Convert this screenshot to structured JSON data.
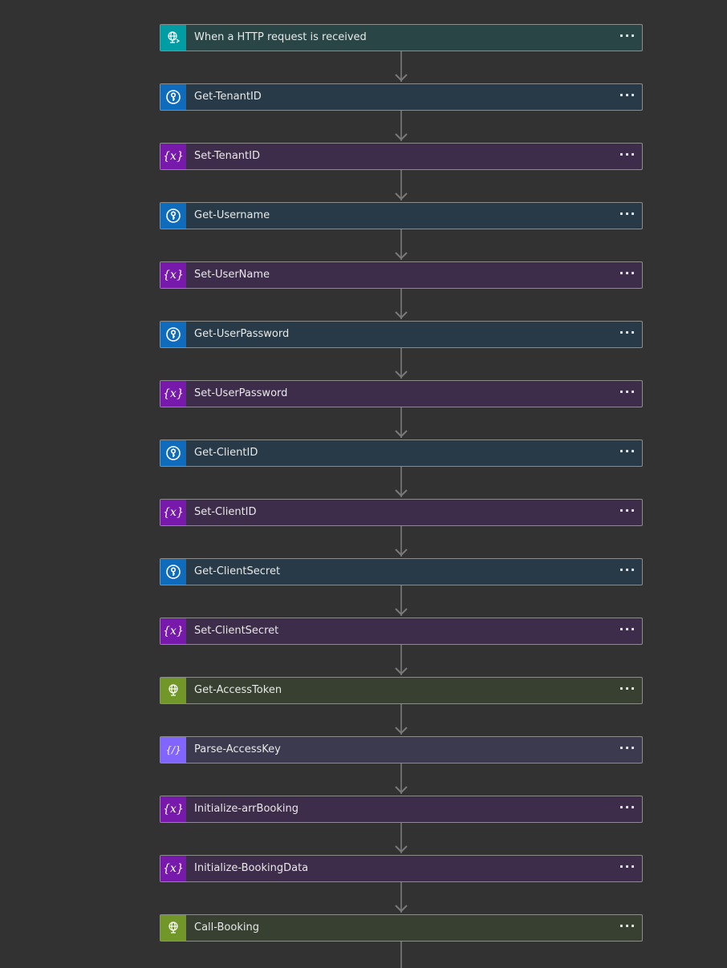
{
  "flow": {
    "steps": [
      {
        "label": "When a HTTP request is received",
        "kind": "request",
        "icon": "request-globe-icon"
      },
      {
        "label": "Get-TenantID",
        "kind": "keyvault",
        "icon": "key-vault-icon"
      },
      {
        "label": "Set-TenantID",
        "kind": "variable",
        "icon": "variable-icon"
      },
      {
        "label": "Get-Username",
        "kind": "keyvault",
        "icon": "key-vault-icon"
      },
      {
        "label": "Set-UserName",
        "kind": "variable",
        "icon": "variable-icon"
      },
      {
        "label": "Get-UserPassword",
        "kind": "keyvault",
        "icon": "key-vault-icon"
      },
      {
        "label": "Set-UserPassword",
        "kind": "variable",
        "icon": "variable-icon"
      },
      {
        "label": "Get-ClientID",
        "kind": "keyvault",
        "icon": "key-vault-icon"
      },
      {
        "label": "Set-ClientID",
        "kind": "variable",
        "icon": "variable-icon"
      },
      {
        "label": "Get-ClientSecret",
        "kind": "keyvault",
        "icon": "key-vault-icon"
      },
      {
        "label": "Set-ClientSecret",
        "kind": "variable",
        "icon": "variable-icon"
      },
      {
        "label": "Get-AccessToken",
        "kind": "http",
        "icon": "http-globe-icon"
      },
      {
        "label": "Parse-AccessKey",
        "kind": "json",
        "icon": "parse-json-icon"
      },
      {
        "label": "Initialize-arrBooking",
        "kind": "variable",
        "icon": "variable-icon"
      },
      {
        "label": "Initialize-BookingData",
        "kind": "variable",
        "icon": "variable-icon"
      },
      {
        "label": "Call-Booking",
        "kind": "http",
        "icon": "http-globe-icon"
      }
    ],
    "more_label": "···"
  },
  "colors": {
    "background": "#323232",
    "connector": "#6b6b6b",
    "request_accent": "#009da5",
    "keyvault_accent": "#0f6cbd",
    "variable_accent": "#7719aa",
    "http_accent": "#709727",
    "json_accent": "#8265ff"
  }
}
